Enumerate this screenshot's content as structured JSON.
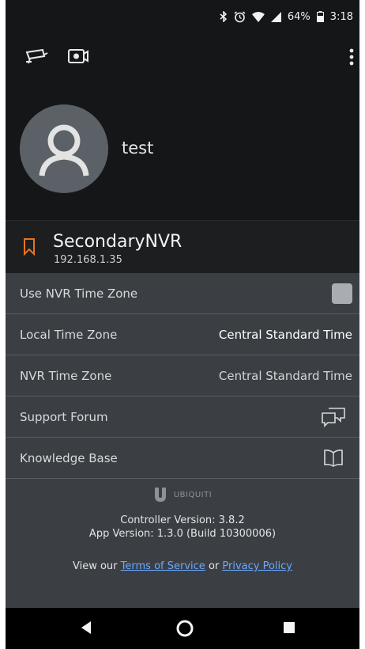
{
  "status_bar": {
    "battery": "64%",
    "time": "3:18",
    "icons": [
      "bluetooth-icon",
      "alarm-icon",
      "wifi-icon",
      "signal-icon",
      "battery-icon"
    ]
  },
  "toolbar": {
    "icons": [
      "security-camera-icon",
      "video-camera-icon",
      "overflow-menu-icon"
    ]
  },
  "profile": {
    "username": "test",
    "avatar_icon": "user-avatar-icon"
  },
  "nvr": {
    "name": "SecondaryNVR",
    "ip": "192.168.1.35",
    "icon": "bookmark-icon",
    "accent_color": "#e8741c"
  },
  "settings": [
    {
      "label": "Use NVR Time Zone",
      "control": "checkbox",
      "checked": false
    },
    {
      "label": "Local Time Zone",
      "value": "Central Standard Time"
    },
    {
      "label": "NVR Time Zone",
      "value": "Central Standard Time"
    },
    {
      "label": "Support Forum",
      "icon": "chat-bubbles-icon"
    },
    {
      "label": "Knowledge Base",
      "icon": "book-icon"
    }
  ],
  "footer": {
    "brand": "UBIQUITI",
    "controller_version": "Controller Version: 3.8.2",
    "app_version": "App Version: 1.3.0 (Build 10300006)",
    "legal_prefix": "View our",
    "terms_label": "Terms of Service",
    "legal_or": "or",
    "privacy_label": "Privacy Policy"
  },
  "nav_bar": {
    "icons": [
      "back-icon",
      "home-icon",
      "recents-icon"
    ]
  },
  "colors": {
    "background": "#151617",
    "list_background": "#3b3f44",
    "link": "#6aa8ff"
  }
}
